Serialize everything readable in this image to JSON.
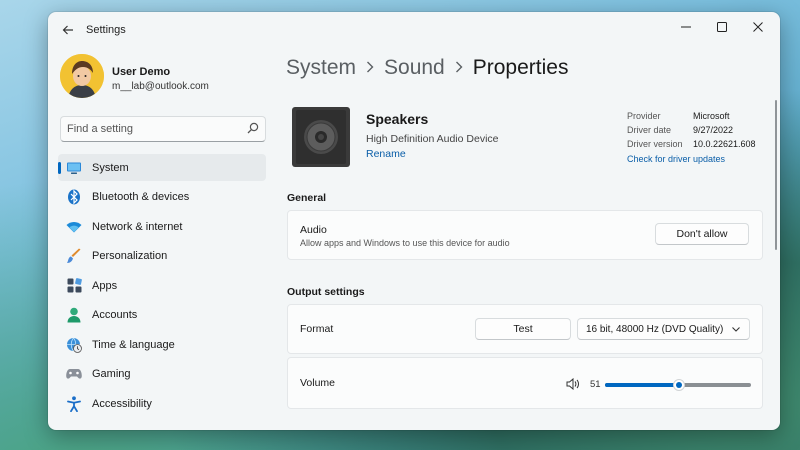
{
  "window": {
    "title": "Settings"
  },
  "profile": {
    "name": "User Demo",
    "email": "m__lab@outlook.com"
  },
  "search": {
    "placeholder": "Find a setting",
    "value": ""
  },
  "sidebar": {
    "items": [
      {
        "label": "System",
        "icon": "monitor-icon",
        "selected": true
      },
      {
        "label": "Bluetooth & devices",
        "icon": "bluetooth-icon"
      },
      {
        "label": "Network & internet",
        "icon": "wifi-icon"
      },
      {
        "label": "Personalization",
        "icon": "brush-icon"
      },
      {
        "label": "Apps",
        "icon": "apps-icon"
      },
      {
        "label": "Accounts",
        "icon": "person-icon"
      },
      {
        "label": "Time & language",
        "icon": "globe-clock-icon"
      },
      {
        "label": "Gaming",
        "icon": "gamepad-icon"
      },
      {
        "label": "Accessibility",
        "icon": "accessibility-icon"
      }
    ]
  },
  "breadcrumb": {
    "part1": "System",
    "part2": "Sound",
    "current": "Properties"
  },
  "device": {
    "name": "Speakers",
    "description": "High Definition Audio Device",
    "rename": "Rename",
    "provider_label": "Provider",
    "provider": "Microsoft",
    "date_label": "Driver date",
    "date": "9/27/2022",
    "version_label": "Driver version",
    "version": "10.0.22621.608",
    "update_link": "Check for driver updates"
  },
  "general": {
    "title": "General",
    "audio_label": "Audio",
    "audio_desc": "Allow apps and Windows to use this device for audio",
    "dont_allow": "Don't allow"
  },
  "output": {
    "title": "Output settings",
    "format_label": "Format",
    "test_label": "Test",
    "format_value": "16 bit, 48000 Hz (DVD Quality)",
    "volume_label": "Volume",
    "volume_value": "51",
    "volume_fraction": 0.51
  },
  "colors": {
    "accent": "#0067c0",
    "link": "#0a5ea8"
  }
}
